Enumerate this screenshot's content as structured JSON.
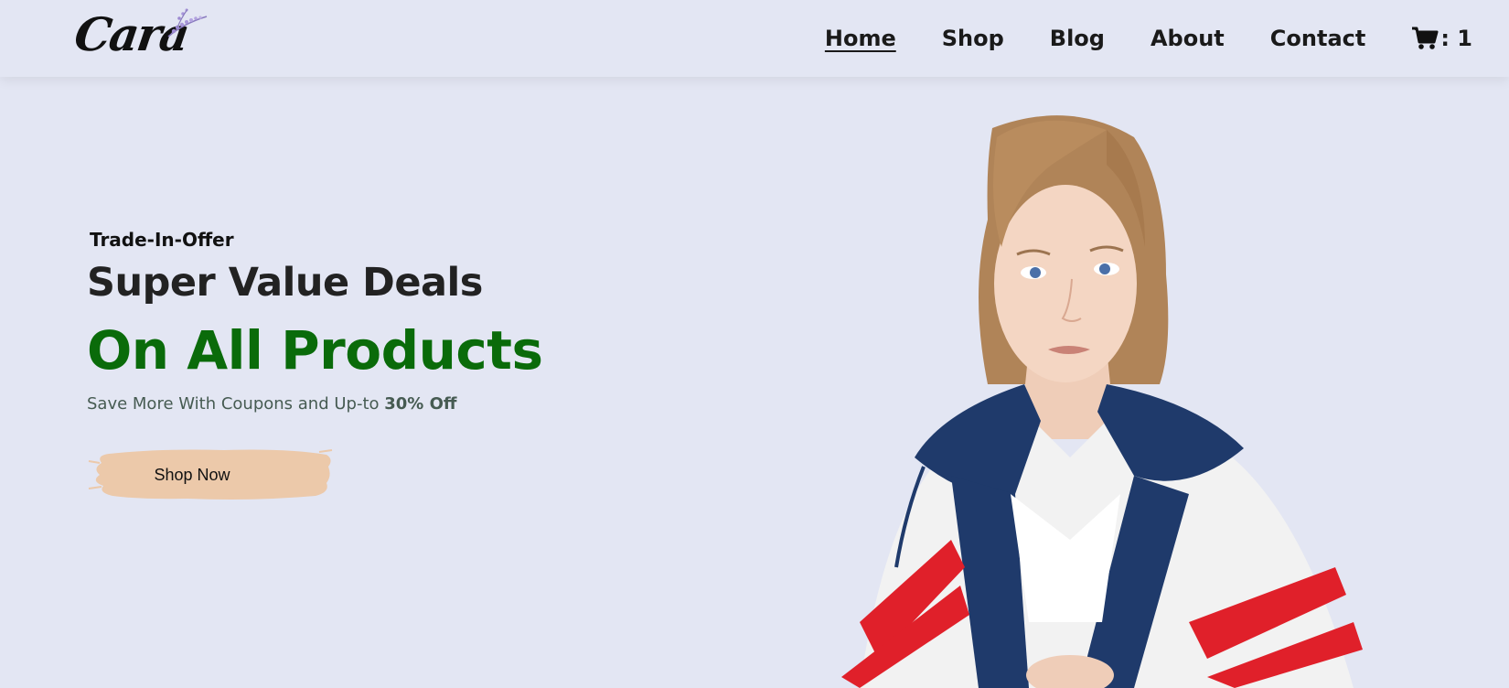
{
  "header": {
    "logo_text": "Cara",
    "nav": [
      {
        "label": "Home",
        "active": true
      },
      {
        "label": "Shop",
        "active": false
      },
      {
        "label": "Blog",
        "active": false
      },
      {
        "label": "About",
        "active": false
      },
      {
        "label": "Contact",
        "active": false
      }
    ],
    "cart_count": ": 1",
    "cart_icon": "shopping-cart-icon"
  },
  "hero": {
    "eyebrow": "Trade-In-Offer",
    "title": "Super Value Deals",
    "highlight": "On All Products",
    "subtitle_prefix": "Save More With Coupons and Up-to ",
    "subtitle_bold": "30% Off",
    "cta_label": "Shop Now"
  },
  "colors": {
    "background": "#e3e6f3",
    "highlight_green": "#0a6b0a",
    "cta_brush": "#ecc9aa",
    "jacket_navy": "#1f3a6b",
    "jacket_red": "#e0202a"
  }
}
